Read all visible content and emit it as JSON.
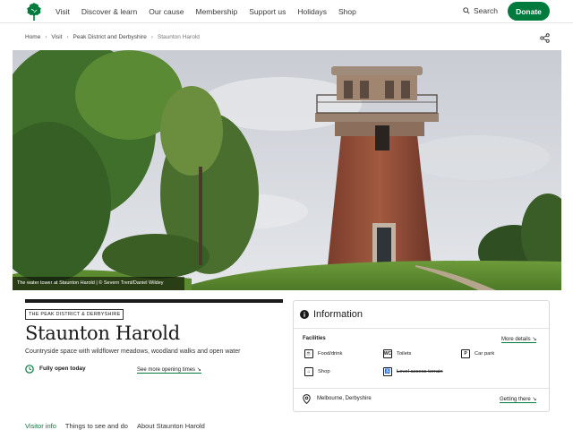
{
  "header": {
    "nav": [
      "Visit",
      "Discover & learn",
      "Our cause",
      "Membership",
      "Support us",
      "Holidays",
      "Shop"
    ],
    "search_label": "Search",
    "donate_label": "Donate",
    "logo_icon": "oak-leaf-logo-icon",
    "brand_color": "#007a3d"
  },
  "breadcrumb": [
    "Home",
    "Visit",
    "Peak District and Derbyshire",
    "Staunton Harold"
  ],
  "hero": {
    "caption": "The water tower at Staunton Harold | © Severn Trent/Daniel Wildey"
  },
  "place": {
    "region_tag": "THE PEAK DISTRICT & DERBYSHIRE",
    "title": "Staunton Harold",
    "subtitle": "Countryside space with wildflower meadows, woodland walks and open water",
    "open_status": "Fully open today",
    "opening_link": "See more opening times ↘"
  },
  "info": {
    "title": "Information",
    "facilities_label": "Facilities",
    "more_details": "More details ↘",
    "facilities": [
      {
        "label": "Food/drink",
        "icon": "food-drink-icon",
        "glyph": "☕"
      },
      {
        "label": "Toilets",
        "icon": "toilets-icon",
        "glyph": "WC"
      },
      {
        "label": "Car park",
        "icon": "car-park-icon",
        "glyph": "P"
      },
      {
        "label": "Shop",
        "icon": "shop-icon",
        "glyph": "⌂"
      },
      {
        "label": "Level access terrain",
        "icon": "level-access-icon",
        "glyph": "♿"
      }
    ],
    "location": "Melbourne, Derbyshire",
    "getting_there": "Getting there ↘"
  },
  "tabs": [
    "Visitor info",
    "Things to see and do",
    "About Staunton Harold"
  ]
}
